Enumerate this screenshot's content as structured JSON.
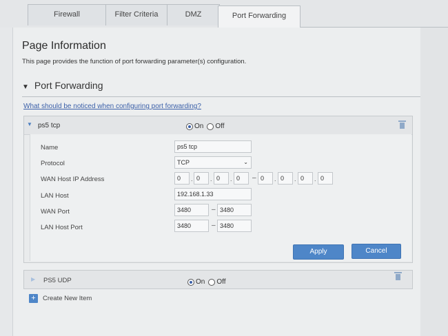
{
  "tabs": [
    {
      "label": "Firewall",
      "active": false
    },
    {
      "label": "Filter Criteria",
      "active": false
    },
    {
      "label": "DMZ",
      "active": false
    },
    {
      "label": "Port Forwarding",
      "active": true
    }
  ],
  "page": {
    "title": "Page Information",
    "description": "This page provides the function of port forwarding parameter(s) configuration."
  },
  "section": {
    "title": "Port Forwarding",
    "notice_link": "What should be noticed when configuring port forwarding?"
  },
  "radio_labels": {
    "on": "On",
    "off": "Off"
  },
  "items": [
    {
      "name": "ps5 tcp",
      "enabled": true,
      "expanded": true,
      "fields": {
        "name_label": "Name",
        "name_value": "ps5 tcp",
        "protocol_label": "Protocol",
        "protocol_value": "TCP",
        "wan_ip_label": "WAN Host IP Address",
        "wan_ip_start": [
          "0",
          "0",
          "0",
          "0"
        ],
        "wan_ip_end": [
          "0",
          "0",
          "0",
          "0"
        ],
        "lan_host_label": "LAN Host",
        "lan_host_value": "192.168.1.33",
        "wan_port_label": "WAN Port",
        "wan_port_start": "3480",
        "wan_port_end": "3480",
        "lan_port_label": "LAN Host Port",
        "lan_port_start": "3480",
        "lan_port_end": "3480"
      },
      "apply_label": "Apply",
      "cancel_label": "Cancel"
    },
    {
      "name": "PS5 UDP",
      "enabled": true,
      "expanded": false
    }
  ],
  "create_label": "Create New Item",
  "colors": {
    "accent": "#4e86c8",
    "link": "#3a5fa8"
  }
}
